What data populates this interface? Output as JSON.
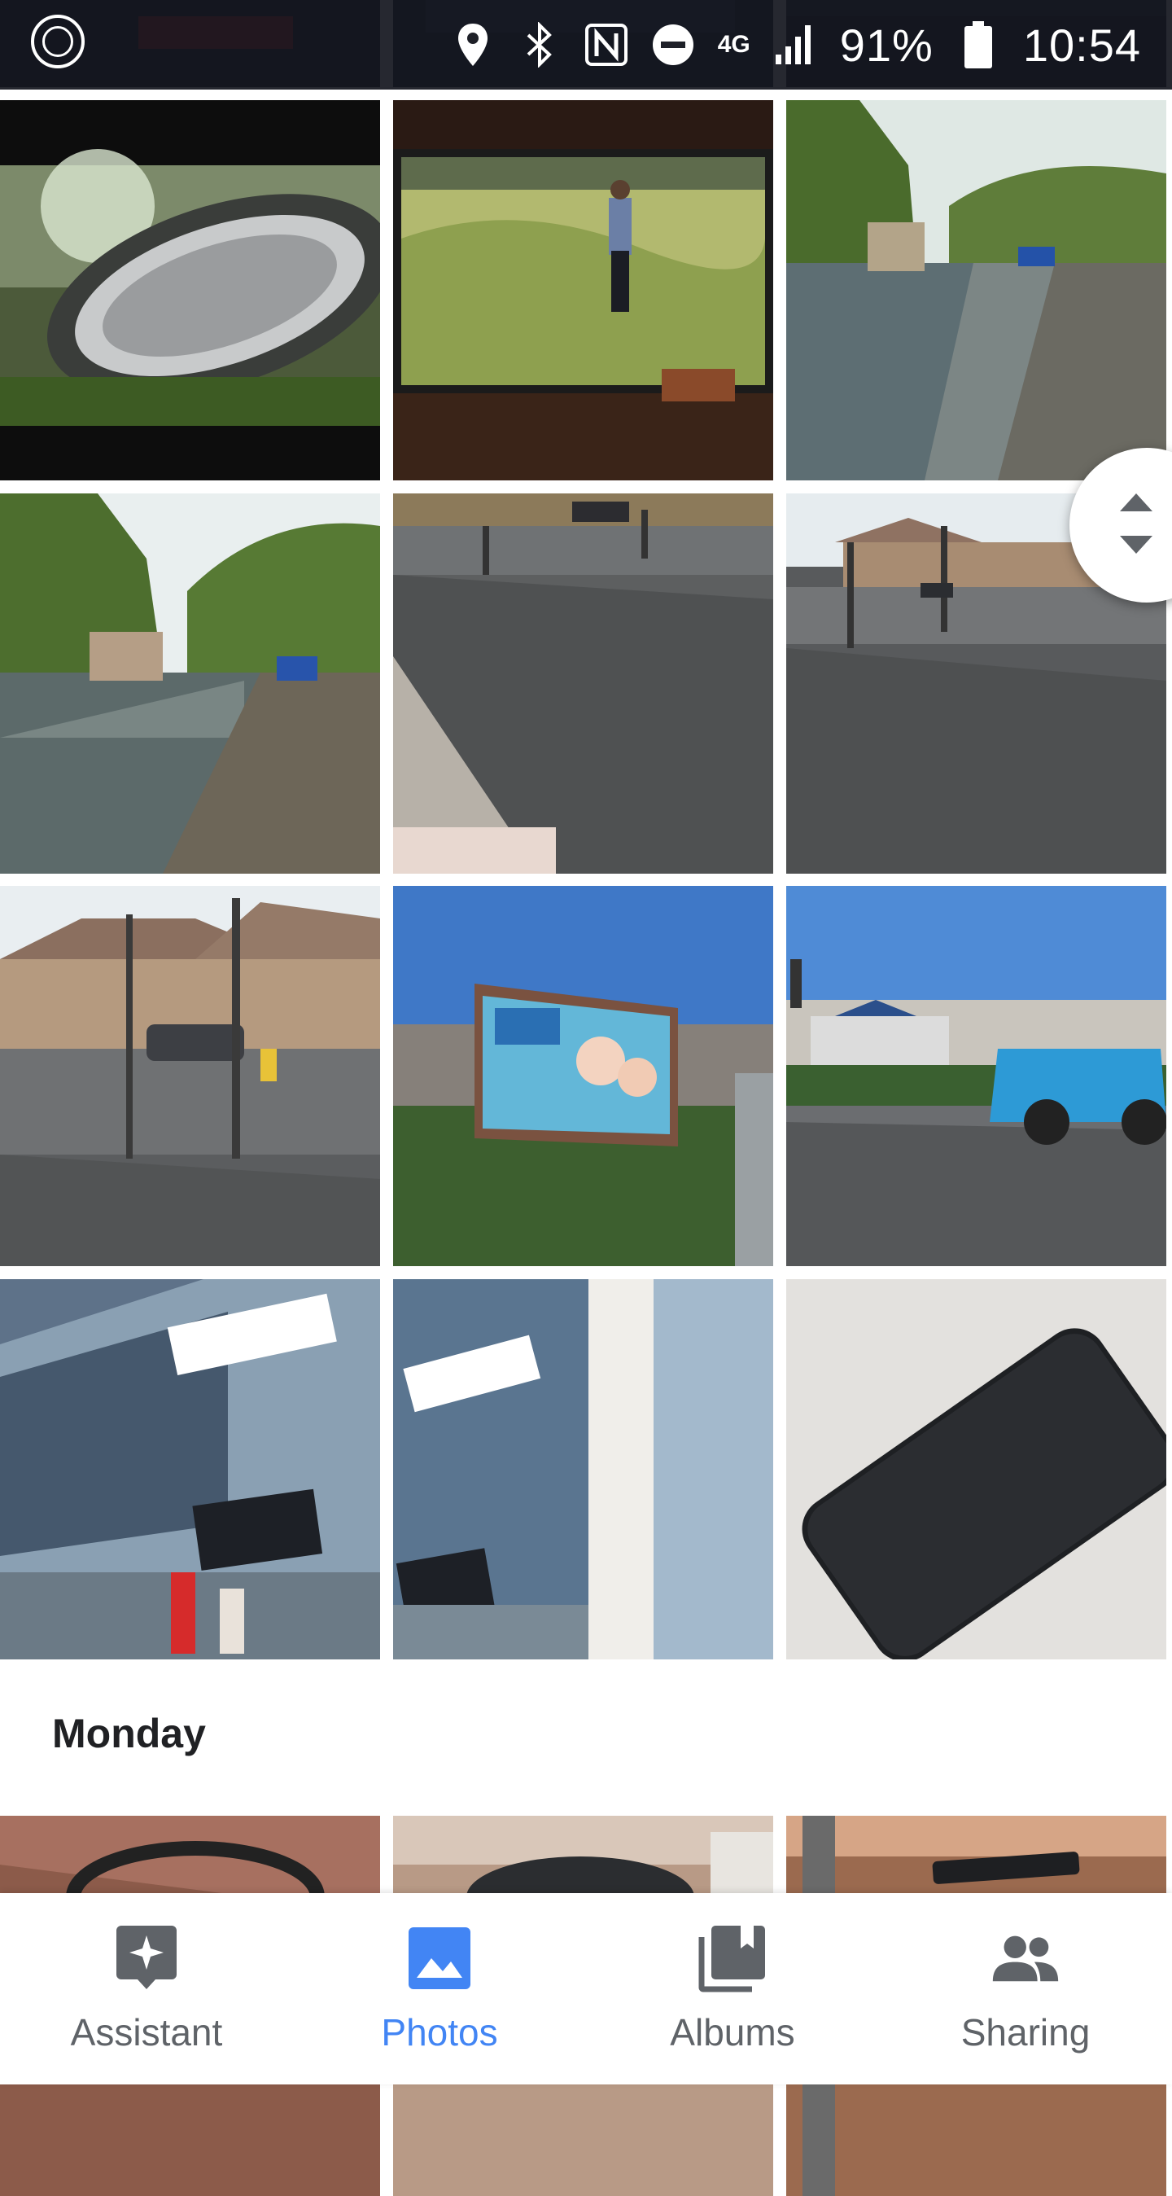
{
  "status_bar": {
    "network": "4G",
    "battery": "91%",
    "time": "10:54"
  },
  "sections": [
    {
      "header": "Monday"
    }
  ],
  "photos": [
    {
      "name": "photo-pga-europro-tour-tv"
    },
    {
      "name": "photo-golfer-on-tv"
    },
    {
      "name": "photo-canal-boat-1"
    },
    {
      "name": "photo-canal-boat-2"
    },
    {
      "name": "photo-road-kerb"
    },
    {
      "name": "photo-road-traffic-lights-1"
    },
    {
      "name": "photo-road-traffic-lights-2"
    },
    {
      "name": "photo-back-to-school-billboard"
    },
    {
      "name": "photo-blue-car-retail-park"
    },
    {
      "name": "photo-costa-next-store"
    },
    {
      "name": "photo-costa-store"
    },
    {
      "name": "photo-phone-on-table"
    },
    {
      "name": "photo-monday-1"
    },
    {
      "name": "photo-monday-2"
    },
    {
      "name": "photo-monday-3"
    }
  ],
  "bottom_nav": {
    "items": [
      {
        "label": "Assistant",
        "icon": "assistant-icon",
        "active": false
      },
      {
        "label": "Photos",
        "icon": "photos-icon",
        "active": true
      },
      {
        "label": "Albums",
        "icon": "albums-icon",
        "active": false
      },
      {
        "label": "Sharing",
        "icon": "sharing-icon",
        "active": false
      }
    ]
  },
  "colors": {
    "accent": "#4285f4",
    "nav_inactive": "#5f6368",
    "text": "#202124"
  }
}
